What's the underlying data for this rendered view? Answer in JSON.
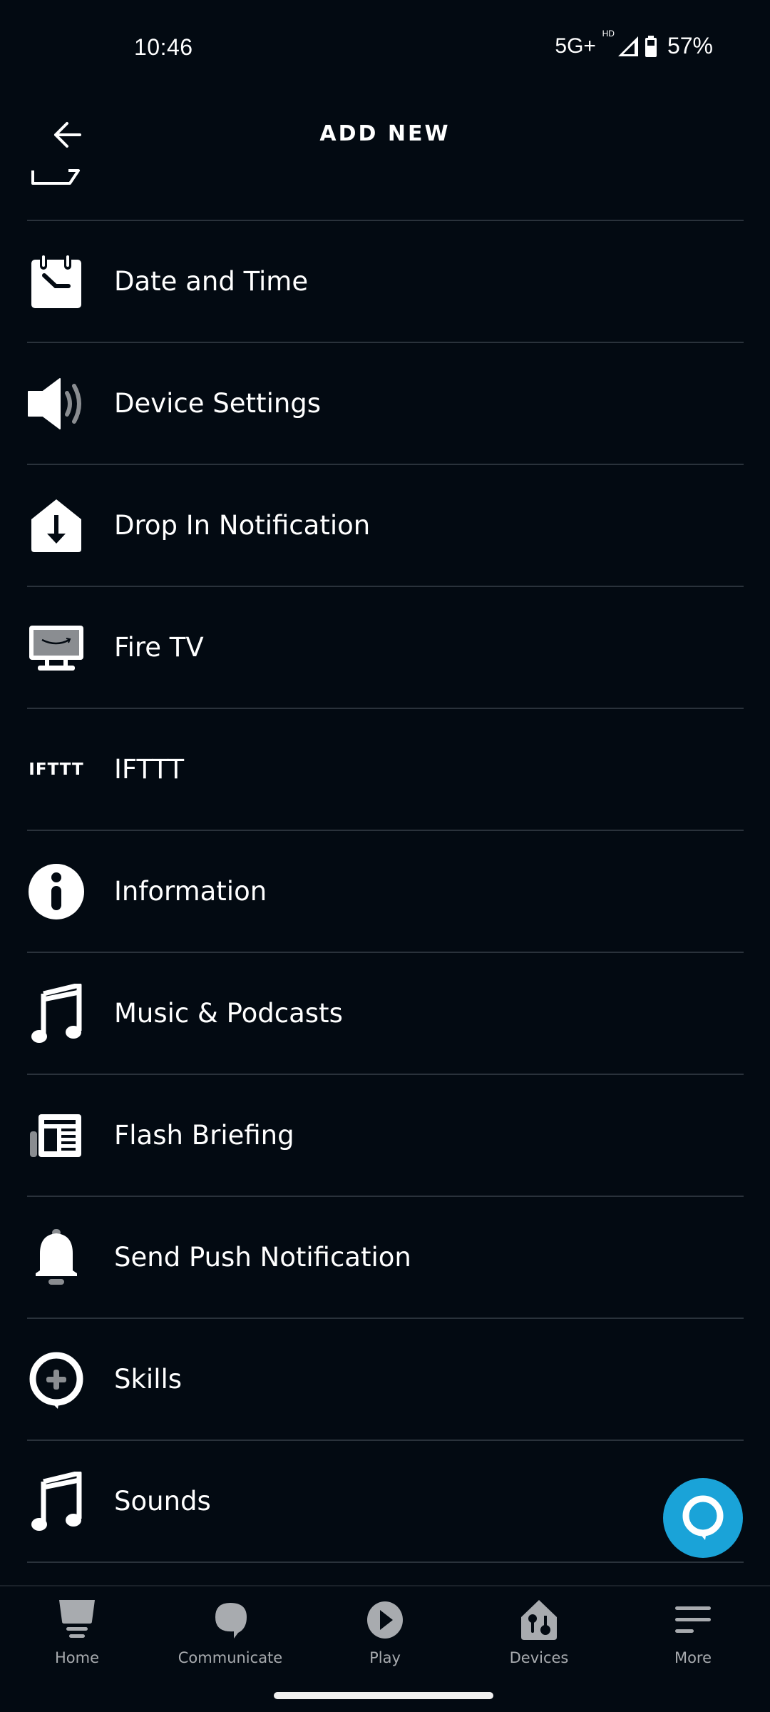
{
  "status_bar": {
    "time": "10:46",
    "network": "5G+",
    "network_badge": "HD",
    "battery_percent": "57%"
  },
  "header": {
    "title": "ADD NEW",
    "back_icon": "arrow-left-icon"
  },
  "list": {
    "partial_item_icon": "message-icon",
    "items": [
      {
        "label": "Date and Time",
        "icon": "calendar-clock-icon"
      },
      {
        "label": "Device Settings",
        "icon": "speaker-icon"
      },
      {
        "label": "Drop In Notification",
        "icon": "drop-in-icon"
      },
      {
        "label": "Fire TV",
        "icon": "tv-icon"
      },
      {
        "label": "IFTTT",
        "icon": "ifttt-icon",
        "icon_text": "IFTTT"
      },
      {
        "label": "Information",
        "icon": "info-icon"
      },
      {
        "label": "Music & Podcasts",
        "icon": "music-note-icon"
      },
      {
        "label": "Flash Briefing",
        "icon": "newspaper-icon"
      },
      {
        "label": "Send Push Notification",
        "icon": "bell-icon"
      },
      {
        "label": "Skills",
        "icon": "skills-icon"
      },
      {
        "label": "Sounds",
        "icon": "music-note-icon"
      }
    ]
  },
  "fab": {
    "icon": "alexa-icon",
    "color": "#1aa3d8"
  },
  "bottom_nav": {
    "items": [
      {
        "label": "Home",
        "icon": "home-icon"
      },
      {
        "label": "Communicate",
        "icon": "chat-bubble-icon"
      },
      {
        "label": "Play",
        "icon": "play-icon"
      },
      {
        "label": "Devices",
        "icon": "devices-icon"
      },
      {
        "label": "More",
        "icon": "menu-icon"
      }
    ]
  },
  "colors": {
    "background": "#030a12",
    "divider": "#2a323b",
    "nav_inactive": "#a8abaf",
    "accent": "#1aa3d8"
  }
}
